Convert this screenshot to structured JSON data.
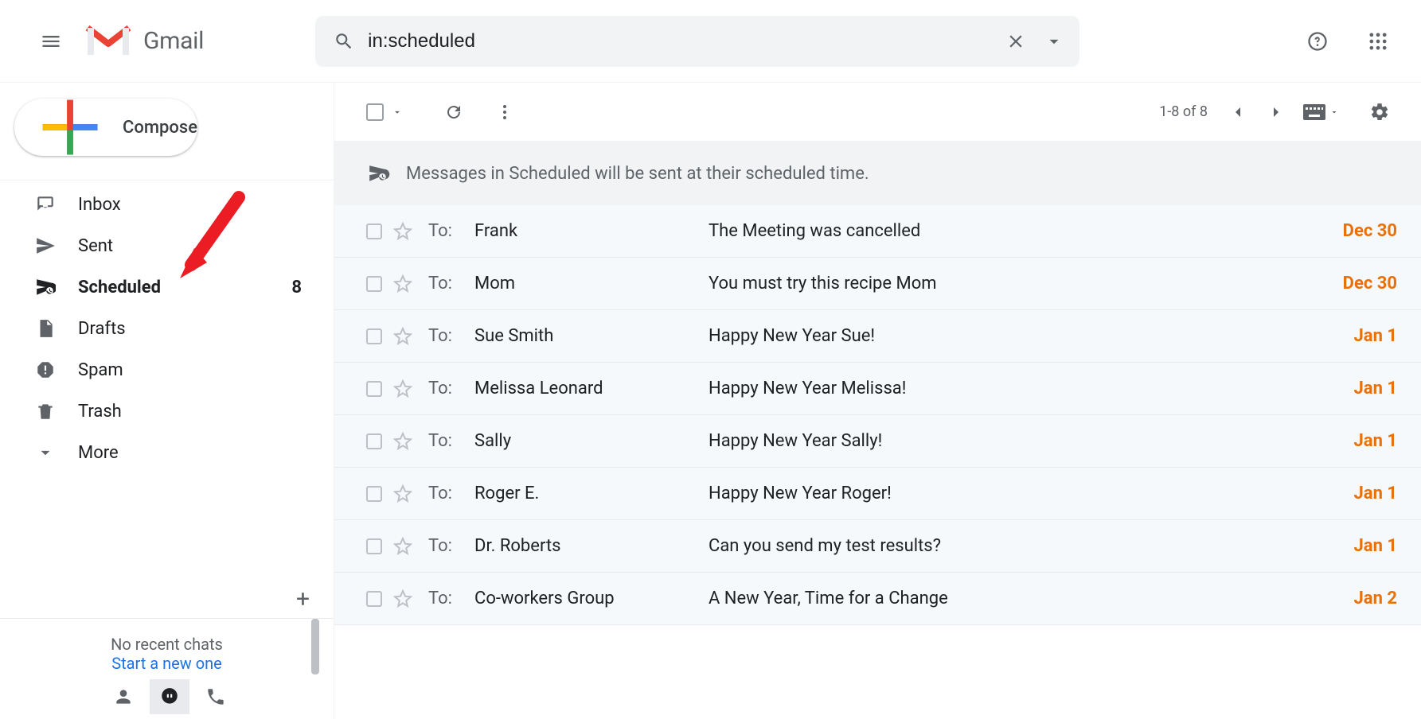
{
  "header": {
    "product_name": "Gmail",
    "search_value": "in:scheduled"
  },
  "sidebar": {
    "compose_label": "Compose",
    "items": [
      {
        "key": "inbox",
        "label": "Inbox",
        "count": ""
      },
      {
        "key": "sent",
        "label": "Sent",
        "count": ""
      },
      {
        "key": "scheduled",
        "label": "Scheduled",
        "count": "8"
      },
      {
        "key": "drafts",
        "label": "Drafts",
        "count": ""
      },
      {
        "key": "spam",
        "label": "Spam",
        "count": ""
      },
      {
        "key": "trash",
        "label": "Trash",
        "count": ""
      },
      {
        "key": "more",
        "label": "More",
        "count": ""
      }
    ],
    "no_chats": "No recent chats",
    "start_new": "Start a new one"
  },
  "toolbar": {
    "range": "1-8 of 8"
  },
  "banner": {
    "text": "Messages in Scheduled will be sent at their scheduled time."
  },
  "colors": {
    "date_accent": "#e8710a",
    "link_blue": "#1a73e8"
  },
  "to_label": "To:",
  "messages": [
    {
      "recipient": "Frank",
      "subject": "The Meeting was cancelled",
      "date": "Dec 30"
    },
    {
      "recipient": "Mom",
      "subject": "You must try this recipe Mom",
      "date": "Dec 30"
    },
    {
      "recipient": "Sue Smith",
      "subject": "Happy New Year Sue!",
      "date": "Jan 1"
    },
    {
      "recipient": "Melissa Leonard",
      "subject": "Happy New Year Melissa!",
      "date": "Jan 1"
    },
    {
      "recipient": "Sally",
      "subject": "Happy New Year Sally!",
      "date": "Jan 1"
    },
    {
      "recipient": "Roger E.",
      "subject": "Happy New Year Roger!",
      "date": "Jan 1"
    },
    {
      "recipient": "Dr. Roberts",
      "subject": "Can you send my test results?",
      "date": "Jan 1"
    },
    {
      "recipient": "Co-workers Group",
      "subject": "A New Year, Time for a Change",
      "date": "Jan 2"
    }
  ]
}
